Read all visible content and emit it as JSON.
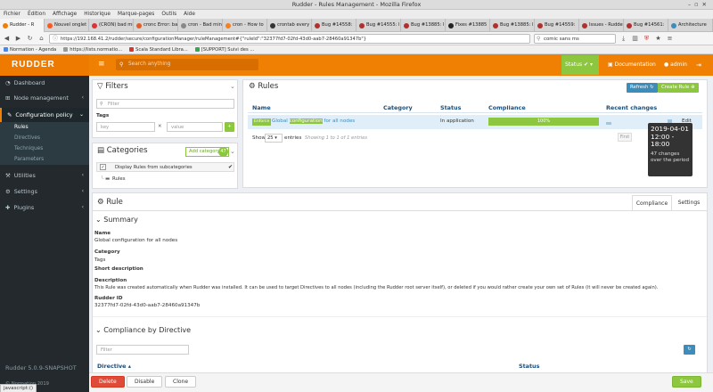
{
  "browser": {
    "window_title": "Rudder - Rules Management - Mozilla Firefox",
    "menu": [
      "Fichier",
      "Édition",
      "Affichage",
      "Historique",
      "Marque-pages",
      "Outils",
      "Aide"
    ],
    "tabs": [
      {
        "label": "Rudder - R",
        "color": "#f08004"
      },
      {
        "label": "Nouvel onglet",
        "color": "#ff5722"
      },
      {
        "label": "(CRON) bad min",
        "color": "#dd3333"
      },
      {
        "label": "cronc Error: ba",
        "color": "#e35d2b"
      },
      {
        "label": "cron - Bad min",
        "color": "#888888"
      },
      {
        "label": "cron - How to",
        "color": "#f48024"
      },
      {
        "label": "crontab every",
        "color": "#333333"
      },
      {
        "label": "Bug #14558: ",
        "color": "#b03030"
      },
      {
        "label": "Bug #14555: l",
        "color": "#b03030"
      },
      {
        "label": "Bug #13885: l",
        "color": "#b03030"
      },
      {
        "label": "Fixes #13885",
        "color": "#222222"
      },
      {
        "label": "Bug #13885: l",
        "color": "#b03030"
      },
      {
        "label": "Bug #14559: ",
        "color": "#b03030"
      },
      {
        "label": "Issues - Rudde",
        "color": "#b03030"
      },
      {
        "label": "Bug #14561: ",
        "color": "#b03030"
      },
      {
        "label": "Architecture",
        "color": "#3c8dbc"
      }
    ],
    "url": "https://192.168.41.2/rudder/secure/configurationManager/ruleManagement#{\"ruleId\":\"32377fd7-02fd-43d0-aab7-28460a91347b\"}",
    "search_placeholder": "comic sans ms",
    "bookmarks": [
      {
        "label": "Normation - Agenda",
        "color": "#4a86e8"
      },
      {
        "label": "https://lists.normatio...",
        "color": "#999999"
      },
      {
        "label": "Scala Standard Libra...",
        "color": "#dd3333"
      },
      {
        "label": "[SUPPORT] Suivi des ...",
        "color": "#34a853"
      }
    ],
    "status_url": "javascript:()"
  },
  "header": {
    "logo": "RUDDER",
    "search_placeholder": "Search anything",
    "status_label": "Status",
    "documentation_label": "Documentation",
    "user_label": "admin"
  },
  "sidebar": {
    "items": [
      {
        "label": "Dashboard",
        "icon": "dashboard-icon"
      },
      {
        "label": "Node management",
        "icon": "sitemap-icon"
      },
      {
        "label": "Configuration policy",
        "icon": "tools-icon"
      },
      {
        "label": "Utilities",
        "icon": "utilities-icon"
      },
      {
        "label": "Settings",
        "icon": "gear-icon"
      },
      {
        "label": "Plugins",
        "icon": "puzzle-icon"
      }
    ],
    "sub_items": [
      "Rules",
      "Directives",
      "Techniques",
      "Parameters"
    ],
    "version": "Rudder 5.0.9-SNAPSHOT",
    "copyright": "© Normation 2019"
  },
  "filters": {
    "title": "Filters",
    "filter_placeholder": "Filter",
    "tags_label": "Tags",
    "key_placeholder": "key",
    "value_placeholder": "value"
  },
  "categories": {
    "title": "Categories",
    "add_label": "Add category",
    "count": "47",
    "checkbox_label": "Display Rules from subcategories",
    "tree_item": "Rules"
  },
  "rules": {
    "title": "Rules",
    "refresh_label": "Refresh",
    "create_label": "Create Rule",
    "columns": [
      "Name",
      "Category",
      "Status",
      "Compliance",
      "Recent changes"
    ],
    "row": {
      "badge": "Enforce",
      "name_pre": "Global ",
      "name_highlight": "configuration",
      "name_post": " for all nodes",
      "status": "In application",
      "compliance": "100%",
      "compliance_value": 100,
      "edit": "Edit"
    },
    "show_label": "Show",
    "page_size": "25",
    "entries_label": "entries",
    "info": "Showing 1 to 1 of 1 entries",
    "first_label": "First",
    "tooltip_time": "2019-04-01 12:00 - 18:00",
    "tooltip_changes": "47 changes over the period"
  },
  "rule_detail": {
    "title": "Rule",
    "tabs": [
      "Compliance",
      "Settings"
    ],
    "summary_title": "Summary",
    "name_label": "Name",
    "name_value": "Global configuration for all nodes",
    "category_label": "Category",
    "category_value": "Tags",
    "short_desc_label": "Short description",
    "desc_label": "Description",
    "desc_value": "This Rule was created automatically when Rudder was installed. It can be used to target Directives to all nodes (including the Rudder root server itself), or deleted if you would rather create your own set of Rules (it will never be created again).",
    "id_label": "Rudder ID",
    "id_value": "32377fd7-02fd-43d0-aab7-28460a91347b",
    "compliance_title": "Compliance by Directive",
    "filter_placeholder": "Filter",
    "col_directive": "Directive",
    "col_status": "Status"
  },
  "footer": {
    "delete_label": "Delete",
    "disable_label": "Disable",
    "clone_label": "Clone",
    "save_label": "Save"
  },
  "colors": {
    "brand": "#f08004",
    "success": "#8dc63f",
    "primary": "#3c8dbc",
    "danger": "#dd4b39",
    "sidebar": "#23292d"
  }
}
